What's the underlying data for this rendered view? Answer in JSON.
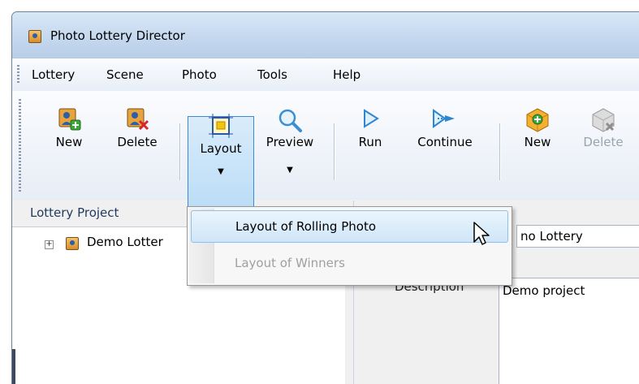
{
  "window": {
    "title": "Photo Lottery Director"
  },
  "menu": [
    "Lottery",
    "Scene",
    "Photo",
    "Tools",
    "Help"
  ],
  "toolbar": {
    "buttons": [
      {
        "label": "New",
        "icon": "lottery-new-icon",
        "enabled": true
      },
      {
        "label": "Delete",
        "icon": "lottery-delete-icon",
        "enabled": true
      },
      {
        "label": "Layout",
        "icon": "layout-icon",
        "enabled": true,
        "pressed": true,
        "has_dropdown": true
      },
      {
        "label": "Preview",
        "icon": "preview-magnifier-icon",
        "enabled": true,
        "has_dropdown": true
      },
      {
        "label": "Run",
        "icon": "run-play-icon",
        "enabled": true
      },
      {
        "label": "Continue",
        "icon": "continue-play-icon",
        "enabled": true
      },
      {
        "label": "New",
        "icon": "scene-new-icon",
        "enabled": true
      },
      {
        "label": "Delete",
        "icon": "scene-delete-icon",
        "enabled": false
      }
    ]
  },
  "left_panel": {
    "header": "Lottery Project",
    "tree": [
      {
        "label": "Demo Lotter",
        "expander": "+"
      }
    ]
  },
  "layout_menu": {
    "items": [
      {
        "label": "Layout of Rolling Photo",
        "state": "hover"
      },
      {
        "label": "Layout of Winners",
        "state": "disabled"
      }
    ]
  },
  "details": {
    "name_value": "no Lottery",
    "description_label": "Description",
    "description_value": "Demo project"
  },
  "colors": {
    "accent": "#3c8ad6",
    "title_bar": "#c3d7ee"
  }
}
